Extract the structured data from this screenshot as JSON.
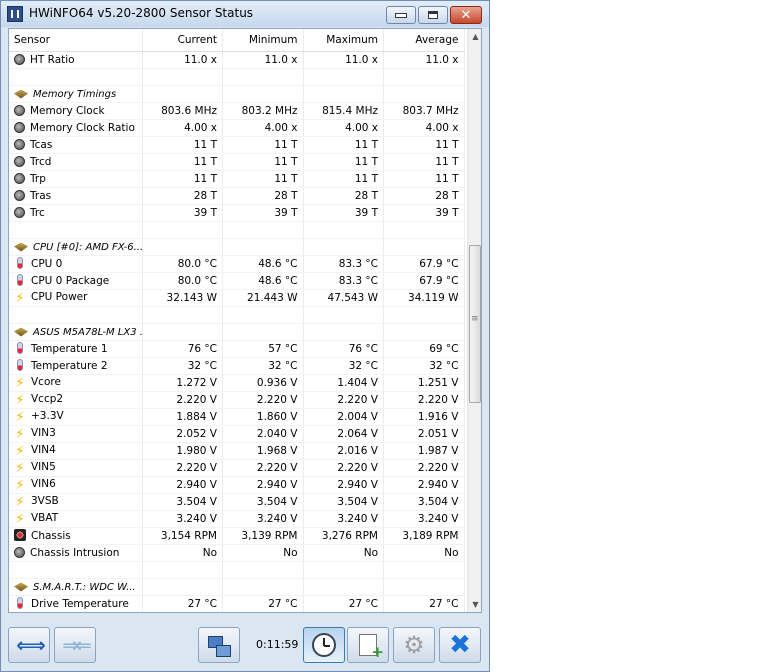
{
  "window": {
    "title": "HWiNFO64 v5.20-2800 Sensor Status"
  },
  "columns": [
    "Sensor",
    "Current",
    "Minimum",
    "Maximum",
    "Average"
  ],
  "rows": [
    {
      "type": "sensor",
      "icon": "gauge-icon",
      "name": "HT Ratio",
      "current": "11.0 x",
      "min": "11.0 x",
      "max": "11.0 x",
      "avg": "11.0 x"
    },
    {
      "type": "empty"
    },
    {
      "type": "group",
      "icon": "chip-icon",
      "name": "Memory Timings"
    },
    {
      "type": "sensor",
      "icon": "gauge-icon",
      "name": "Memory Clock",
      "current": "803.6 MHz",
      "min": "803.2 MHz",
      "max": "815.4 MHz",
      "avg": "803.7 MHz"
    },
    {
      "type": "sensor",
      "icon": "gauge-icon",
      "name": "Memory Clock Ratio",
      "current": "4.00 x",
      "min": "4.00 x",
      "max": "4.00 x",
      "avg": "4.00 x"
    },
    {
      "type": "sensor",
      "icon": "gauge-icon",
      "name": "Tcas",
      "current": "11 T",
      "min": "11 T",
      "max": "11 T",
      "avg": "11 T"
    },
    {
      "type": "sensor",
      "icon": "gauge-icon",
      "name": "Trcd",
      "current": "11 T",
      "min": "11 T",
      "max": "11 T",
      "avg": "11 T"
    },
    {
      "type": "sensor",
      "icon": "gauge-icon",
      "name": "Trp",
      "current": "11 T",
      "min": "11 T",
      "max": "11 T",
      "avg": "11 T"
    },
    {
      "type": "sensor",
      "icon": "gauge-icon",
      "name": "Tras",
      "current": "28 T",
      "min": "28 T",
      "max": "28 T",
      "avg": "28 T"
    },
    {
      "type": "sensor",
      "icon": "gauge-icon",
      "name": "Trc",
      "current": "39 T",
      "min": "39 T",
      "max": "39 T",
      "avg": "39 T"
    },
    {
      "type": "empty"
    },
    {
      "type": "group",
      "icon": "chip-icon",
      "name": "CPU [#0]: AMD FX-6..."
    },
    {
      "type": "sensor",
      "icon": "thermometer-icon",
      "name": "CPU 0",
      "current": "80.0 °C",
      "min": "48.6 °C",
      "max": "83.3 °C",
      "avg": "67.9 °C"
    },
    {
      "type": "sensor",
      "icon": "thermometer-icon",
      "name": "CPU 0 Package",
      "current": "80.0 °C",
      "min": "48.6 °C",
      "max": "83.3 °C",
      "avg": "67.9 °C"
    },
    {
      "type": "sensor",
      "icon": "lightning-icon",
      "name": "CPU Power",
      "current": "32.143 W",
      "min": "21.443 W",
      "max": "47.543 W",
      "avg": "34.119 W"
    },
    {
      "type": "empty"
    },
    {
      "type": "group",
      "icon": "chip-icon",
      "name": "ASUS M5A78L-M LX3 ..."
    },
    {
      "type": "sensor",
      "icon": "thermometer-icon",
      "name": "Temperature 1",
      "current": "76 °C",
      "min": "57 °C",
      "max": "76 °C",
      "avg": "69 °C"
    },
    {
      "type": "sensor",
      "icon": "thermometer-icon",
      "name": "Temperature 2",
      "current": "32 °C",
      "min": "32 °C",
      "max": "32 °C",
      "avg": "32 °C"
    },
    {
      "type": "sensor",
      "icon": "lightning-icon",
      "name": "Vcore",
      "current": "1.272 V",
      "min": "0.936 V",
      "max": "1.404 V",
      "avg": "1.251 V"
    },
    {
      "type": "sensor",
      "icon": "lightning-icon",
      "name": "Vccp2",
      "current": "2.220 V",
      "min": "2.220 V",
      "max": "2.220 V",
      "avg": "2.220 V"
    },
    {
      "type": "sensor",
      "icon": "lightning-icon",
      "name": "+3.3V",
      "current": "1.884 V",
      "min": "1.860 V",
      "max": "2.004 V",
      "avg": "1.916 V"
    },
    {
      "type": "sensor",
      "icon": "lightning-icon",
      "name": "VIN3",
      "current": "2.052 V",
      "min": "2.040 V",
      "max": "2.064 V",
      "avg": "2.051 V"
    },
    {
      "type": "sensor",
      "icon": "lightning-icon",
      "name": "VIN4",
      "current": "1.980 V",
      "min": "1.968 V",
      "max": "2.016 V",
      "avg": "1.987 V"
    },
    {
      "type": "sensor",
      "icon": "lightning-icon",
      "name": "VIN5",
      "current": "2.220 V",
      "min": "2.220 V",
      "max": "2.220 V",
      "avg": "2.220 V"
    },
    {
      "type": "sensor",
      "icon": "lightning-icon",
      "name": "VIN6",
      "current": "2.940 V",
      "min": "2.940 V",
      "max": "2.940 V",
      "avg": "2.940 V"
    },
    {
      "type": "sensor",
      "icon": "lightning-icon",
      "name": "3VSB",
      "current": "3.504 V",
      "min": "3.504 V",
      "max": "3.504 V",
      "avg": "3.504 V"
    },
    {
      "type": "sensor",
      "icon": "lightning-icon",
      "name": "VBAT",
      "current": "3.240 V",
      "min": "3.240 V",
      "max": "3.240 V",
      "avg": "3.240 V"
    },
    {
      "type": "sensor",
      "icon": "fan-icon",
      "name": "Chassis",
      "current": "3,154 RPM",
      "min": "3,139 RPM",
      "max": "3,276 RPM",
      "avg": "3,189 RPM"
    },
    {
      "type": "sensor",
      "icon": "gauge-icon",
      "name": "Chassis Intrusion",
      "current": "No",
      "min": "No",
      "max": "No",
      "avg": "No"
    },
    {
      "type": "empty"
    },
    {
      "type": "group",
      "icon": "chip-icon",
      "name": "S.M.A.R.T.: WDC W..."
    },
    {
      "type": "sensor",
      "icon": "thermometer-icon",
      "name": "Drive Temperature",
      "current": "27 °C",
      "min": "27 °C",
      "max": "27 °C",
      "avg": "27 °C"
    }
  ],
  "toolbar": {
    "elapsed_time": "0:11:59"
  }
}
